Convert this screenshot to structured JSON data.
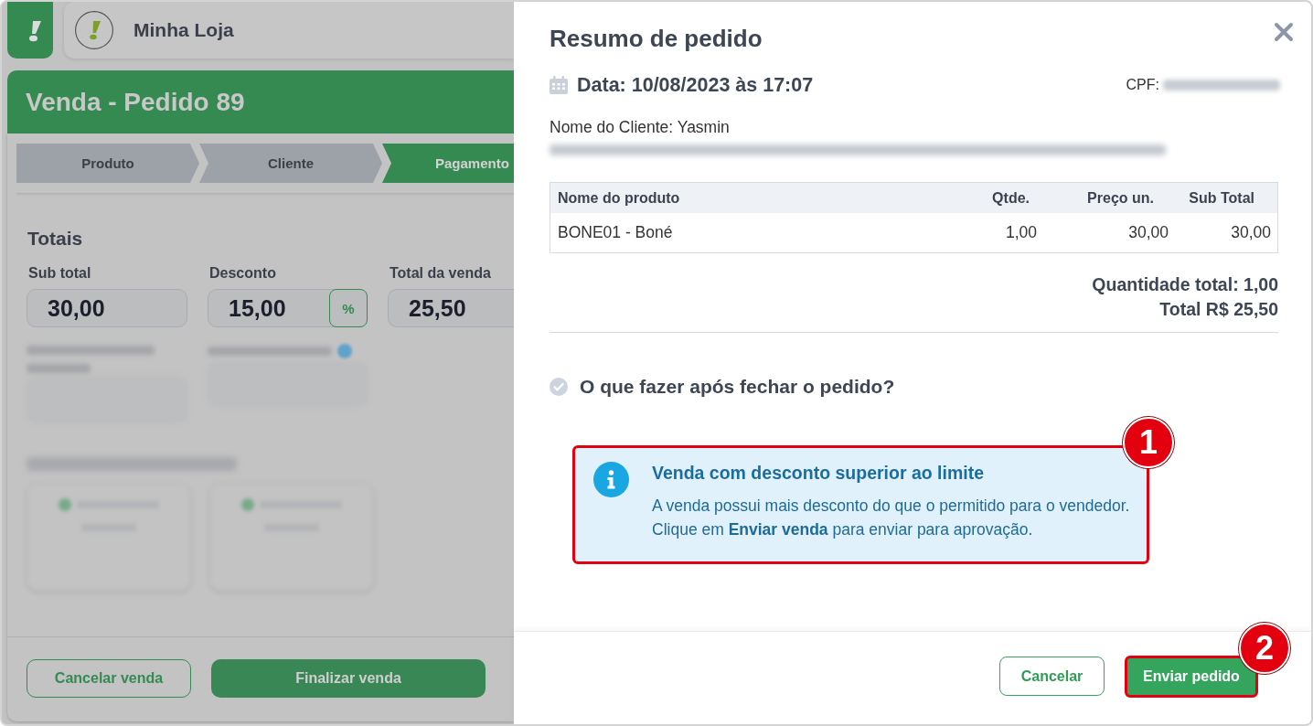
{
  "app_bar": {
    "store_name": "Minha Loja"
  },
  "sale": {
    "title": "Venda - Pedido 89",
    "steps": [
      {
        "label": "Produto",
        "selected": false
      },
      {
        "label": "Cliente",
        "selected": false
      },
      {
        "label": "Pagamento",
        "selected": true
      }
    ],
    "totals": {
      "heading": "Totais",
      "fields": [
        {
          "label": "Sub total",
          "value": "30,00"
        },
        {
          "label": "Desconto",
          "value": "15,00",
          "toggle": "%"
        },
        {
          "label": "Total da venda",
          "value": "25,50"
        }
      ]
    },
    "blurred_content": true,
    "buttons": [
      {
        "label": "Cancelar venda",
        "kind": "secondary"
      },
      {
        "label": "Finalizar venda",
        "kind": "primary"
      }
    ]
  },
  "order_summary": {
    "title": "Resumo de pedido",
    "date": "Data: 10/08/2023 às 17:07",
    "cpf": {
      "label": "CPF:",
      "redacted": true
    },
    "customer": "Nome do Cliente: Yasmin",
    "address_redacted": true,
    "table": {
      "columns": [
        "Nome do produto",
        "Qtde.",
        "Preço un.",
        "Sub Total"
      ],
      "rows": [
        [
          "BONE01 - Boné",
          "1,00",
          "30,00",
          "30,00"
        ]
      ]
    },
    "quantity_total": "Quantidade total: 1,00",
    "total": "Total R$ 25,50",
    "next_step": "O que fazer após fechar o pedido?",
    "alert": {
      "title": "Venda com desconto superior ao limite",
      "message": "A venda possui mais desconto do que o permitido para o vendedor. Clique em **Enviar venda** para enviar para aprovação.",
      "highlighted": true,
      "marker": "1"
    },
    "buttons": [
      {
        "label": "Cancelar",
        "kind": "secondary",
        "highlighted": false
      },
      {
        "label": "Enviar pedido",
        "kind": "primary",
        "highlighted": true,
        "marker": "2"
      }
    ]
  }
}
